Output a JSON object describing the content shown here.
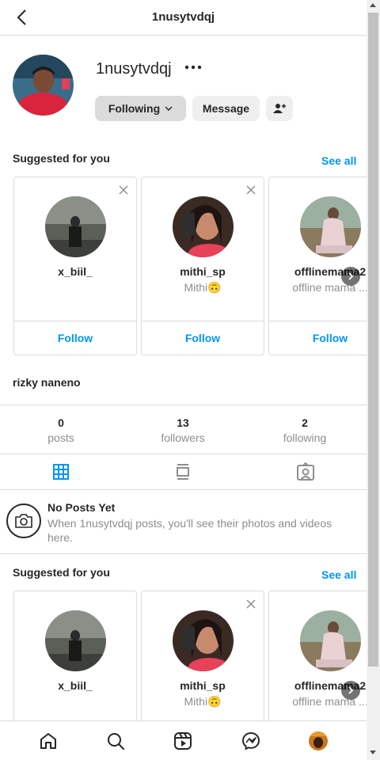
{
  "header": {
    "title": "1nusytvdqj"
  },
  "profile": {
    "username": "1nusytvdqj",
    "following_label": "Following",
    "message_label": "Message",
    "full_name": "rizky naneno"
  },
  "suggested_top": {
    "title": "Suggested for you",
    "see_all": "See all",
    "cards": [
      {
        "username": "x_biil_",
        "subtitle": "",
        "follow_label": "Follow"
      },
      {
        "username": "mithi_sp",
        "subtitle": "Mithi🙃",
        "follow_label": "Follow"
      },
      {
        "username": "offlinemama2",
        "subtitle": "offline mama ...",
        "follow_label": "Follow"
      }
    ]
  },
  "stats": [
    {
      "value": "0",
      "label": "posts"
    },
    {
      "value": "13",
      "label": "followers"
    },
    {
      "value": "2",
      "label": "following"
    }
  ],
  "empty_state": {
    "title": "No Posts Yet",
    "text": "When 1nusytvdqj posts, you'll see their photos and videos here."
  },
  "suggested_bottom": {
    "title": "Suggested for you",
    "see_all": "See all",
    "cards": [
      {
        "username": "x_biil_",
        "subtitle": ""
      },
      {
        "username": "mithi_sp",
        "subtitle": "Mithi🙃"
      },
      {
        "username": "offlinemama2",
        "subtitle": "offline mama ..."
      }
    ]
  },
  "colors": {
    "accent": "#0095f6",
    "text": "#262626",
    "muted": "#8e8e8e",
    "border": "#dbdbdb"
  },
  "icons": [
    "back-icon",
    "more-icon",
    "chevron-down-icon",
    "add-user-icon",
    "close-icon",
    "grid-icon",
    "reels-feed-icon",
    "tagged-icon",
    "camera-icon",
    "home-icon",
    "search-icon",
    "reels-icon",
    "messenger-icon"
  ]
}
